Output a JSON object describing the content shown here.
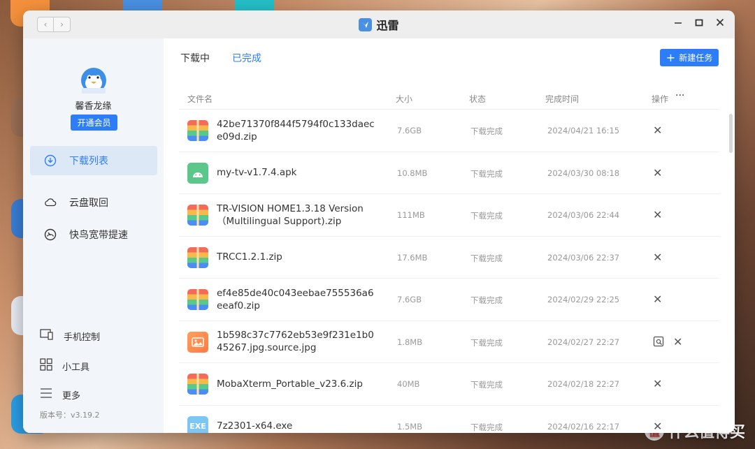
{
  "window": {
    "title": "迅雷",
    "nav_back": "‹",
    "nav_forward": "›"
  },
  "sidebar": {
    "username": "馨香龙缘",
    "vip_button": "开通会员",
    "items": [
      {
        "label": "下载列表",
        "icon": "download-circle-icon",
        "active": true
      },
      {
        "label": "云盘取回",
        "icon": "cloud-icon",
        "active": false
      },
      {
        "label": "快鸟宽带提速",
        "icon": "speedometer-icon",
        "active": false
      }
    ],
    "bottom_items": [
      {
        "label": "手机控制",
        "icon": "phone-control-icon"
      },
      {
        "label": "小工具",
        "icon": "tools-grid-icon"
      },
      {
        "label": "更多",
        "icon": "menu-icon"
      }
    ],
    "version": "版本号：v3.19.2"
  },
  "main": {
    "tabs": [
      {
        "label": "下载中",
        "active": false
      },
      {
        "label": "已完成",
        "active": true
      }
    ],
    "new_task_label": "新建任务",
    "columns": {
      "name": "文件名",
      "size": "大小",
      "status": "状态",
      "time": "完成时间",
      "action": "操作",
      "more": "···"
    },
    "rows": [
      {
        "name": "42be71370f844f5794f0c133daece09d.zip",
        "size": "7.6GB",
        "status": "下载完成",
        "time": "2024/04/21 16:15",
        "type": "zip"
      },
      {
        "name": "my-tv-v1.7.4.apk",
        "size": "10.8MB",
        "status": "下载完成",
        "time": "2024/03/30 08:18",
        "type": "apk"
      },
      {
        "name": "TR-VISION HOME1.3.18 Version（Multilingual Support).zip",
        "size": "111MB",
        "status": "下载完成",
        "time": "2024/03/06 22:44",
        "type": "zip"
      },
      {
        "name": "TRCC1.2.1.zip",
        "size": "17.6MB",
        "status": "下载完成",
        "time": "2024/03/06 22:37",
        "type": "zip"
      },
      {
        "name": "ef4e85de40c043eebae755536a6eeaf0.zip",
        "size": "7.6GB",
        "status": "下载完成",
        "time": "2024/02/29 22:25",
        "type": "zip"
      },
      {
        "name": "1b598c37c7762eb53e9f231e1b045267.jpg.source.jpg",
        "size": "1.8MB",
        "status": "下载完成",
        "time": "2024/02/27 22:27",
        "type": "img"
      },
      {
        "name": "MobaXterm_Portable_v23.6.zip",
        "size": "40MB",
        "status": "下载完成",
        "time": "2024/02/18 22:27",
        "type": "zip"
      },
      {
        "name": "7z2301-x64.exe",
        "size": "1.5MB",
        "status": "下载完成",
        "time": "2024/02/16 22:17",
        "type": "exe",
        "icon_text": "EXE"
      }
    ]
  },
  "watermark": {
    "text": "什么值得买",
    "badge": "值"
  },
  "colors": {
    "accent": "#2d7ef6",
    "sidebar_bg": "#f2f5f9",
    "active_item_bg": "#dde8f7"
  }
}
